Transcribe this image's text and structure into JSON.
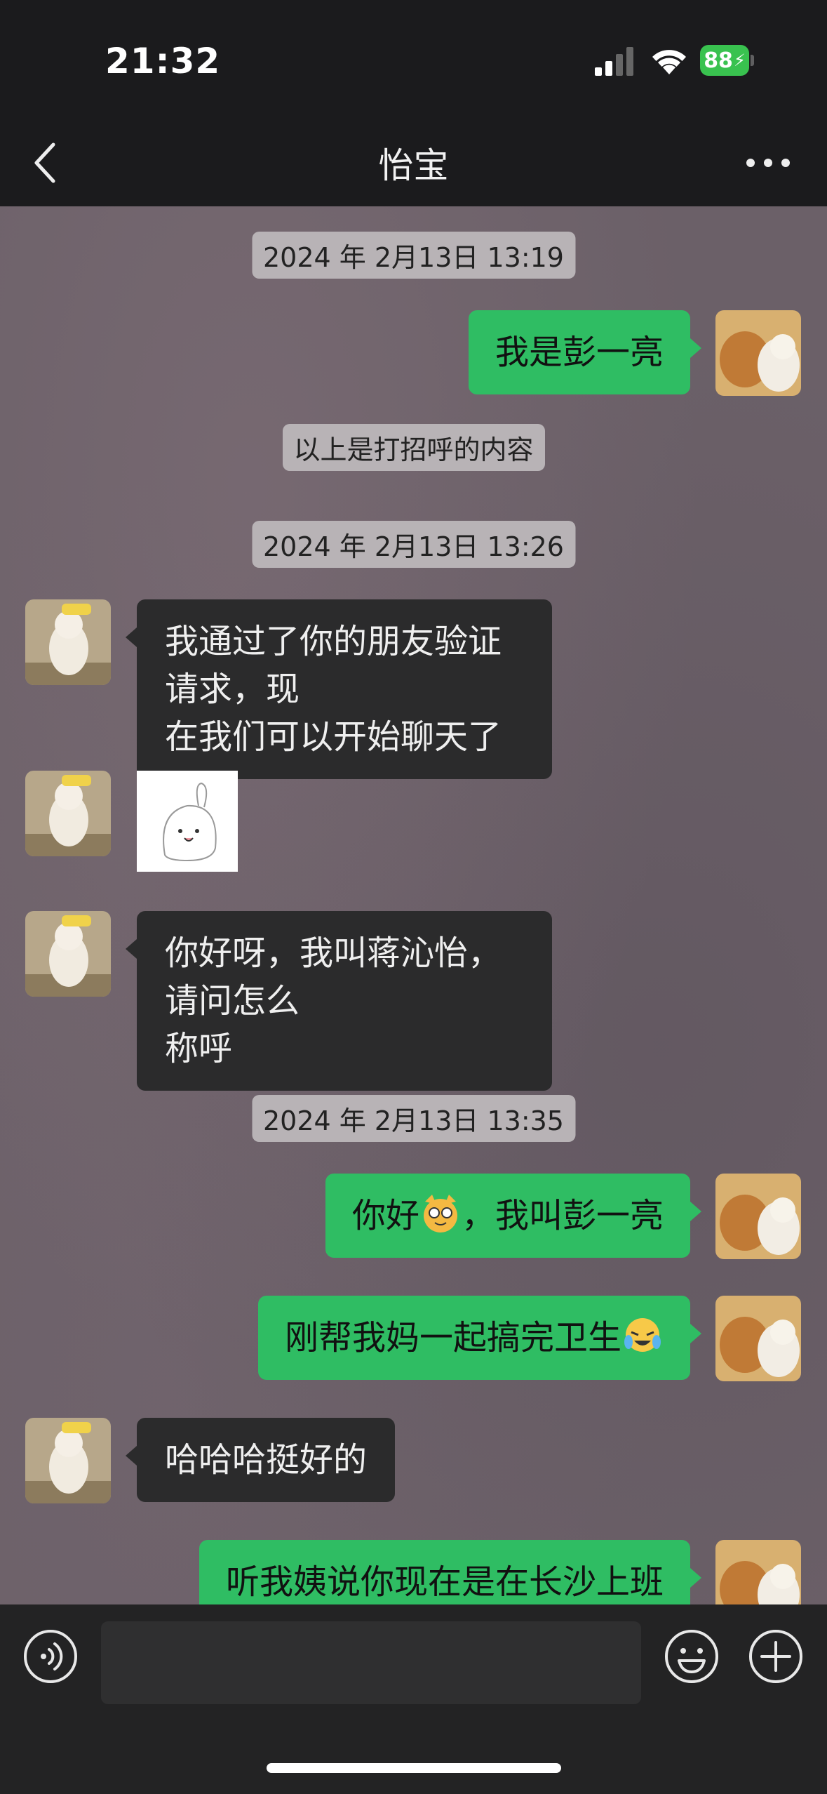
{
  "status": {
    "time": "21:32",
    "battery": "88"
  },
  "header": {
    "title": "怡宝"
  },
  "messages": {
    "stamp1": "2024 年 2月13日 13:19",
    "m1": "我是彭一亮",
    "sys1": "以上是打招呼的内容",
    "stamp2": "2024 年 2月13日 13:26",
    "m2_line1": "我通过了你的朋友验证请求，现",
    "m2_line2": "在我们可以开始聊天了",
    "m4_line1": "你好呀，我叫蒋沁怡，请问怎么",
    "m4_line2": "称呼",
    "stamp3": "2024 年 2月13日 13:35",
    "m5_pre": "你好",
    "m5_post": "，我叫彭一亮",
    "m6": "刚帮我妈一起搞完卫生",
    "m7": "哈哈哈挺好的",
    "m8": "听我姨说你现在是在长沙上班"
  },
  "icons": {
    "back": "chevron-left-icon",
    "more": "ellipsis-icon",
    "voice": "voice-icon",
    "emoji": "smiley-icon",
    "plus": "plus-icon",
    "emoji_in_m5": "cat-with-glasses-emoji",
    "emoji_in_m6": "crying-laughing-emoji"
  },
  "input": {
    "value": ""
  },
  "colors": {
    "outgoing_bubble": "#2fbd63",
    "incoming_bubble": "#2b2b2c",
    "battery": "#39c24f"
  }
}
